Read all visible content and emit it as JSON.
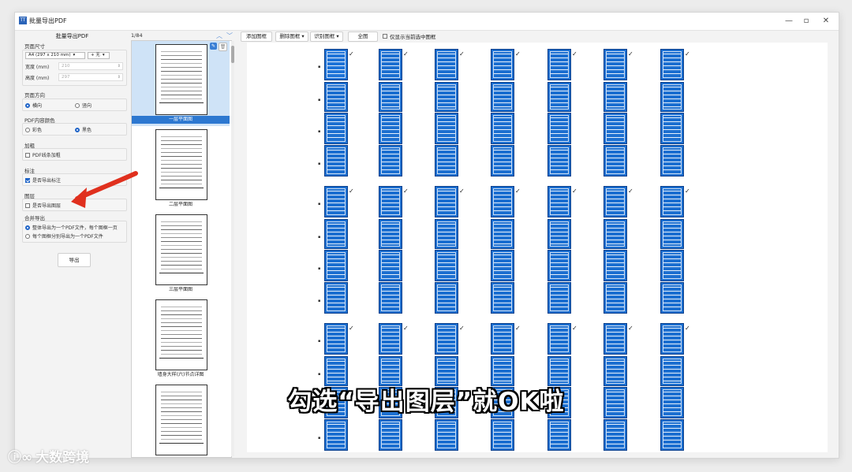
{
  "window": {
    "title": "批量导出PDF",
    "app_icon": "TT",
    "controls": {
      "minimize": "—",
      "maximize": "▫",
      "close": "✕"
    }
  },
  "left_panel": {
    "heading": "批量导出PDF",
    "page_size": {
      "label": "页面尺寸",
      "paper": "A4 (297 x 210 mm)",
      "paper_arrow": "▾",
      "orientation_sym": "+ 无",
      "width_label": "宽度 (mm)",
      "width_value": "210",
      "height_label": "高度 (mm)",
      "height_value": "297"
    },
    "page_direction": {
      "label": "页面方向",
      "horizontal": "横向",
      "vertical": "竖向",
      "selected": "横向"
    },
    "pdf_color": {
      "label": "PDF内容颜色",
      "color": "彩色",
      "black": "黑色",
      "selected": "黑色"
    },
    "bold": {
      "label": "加粗",
      "option": "PDF线条加粗",
      "checked": false
    },
    "annotation": {
      "label": "标注",
      "option": "是否导出标注",
      "checked": true
    },
    "layer": {
      "label": "图层",
      "option": "是否导出图层",
      "checked": false
    },
    "merge": {
      "label": "合并导出",
      "option1": "整体导出为一个PDF文件，每个图框一页",
      "option2": "每个图框分别导出为一个PDF文件",
      "selected": 1
    },
    "export_button": "导出"
  },
  "thumbnails": {
    "counter": "1/84",
    "items": [
      {
        "caption": "一层平面图",
        "active": true
      },
      {
        "caption": "二层平面图",
        "active": false
      },
      {
        "caption": "三层平面图",
        "active": false
      },
      {
        "caption": "墙身大样(六)节点详图",
        "active": false
      },
      {
        "caption": "",
        "active": false
      }
    ]
  },
  "toolbar": {
    "add_frame": "添加图框",
    "delete_frame": "删除图框",
    "identify_frame": "识别图框",
    "full_view": "全图",
    "only_show_selected": "仅显示当前选中图框"
  },
  "canvas": {
    "columns": 7,
    "row_groups": 3,
    "selected_frame_color": "#1f74d8",
    "frame_color": "#1c6fd0"
  },
  "overlay": {
    "subtitle": "勾选“导出图层”就OK啦",
    "watermark": "大数跨境",
    "arrow_color": "#e0301e"
  }
}
